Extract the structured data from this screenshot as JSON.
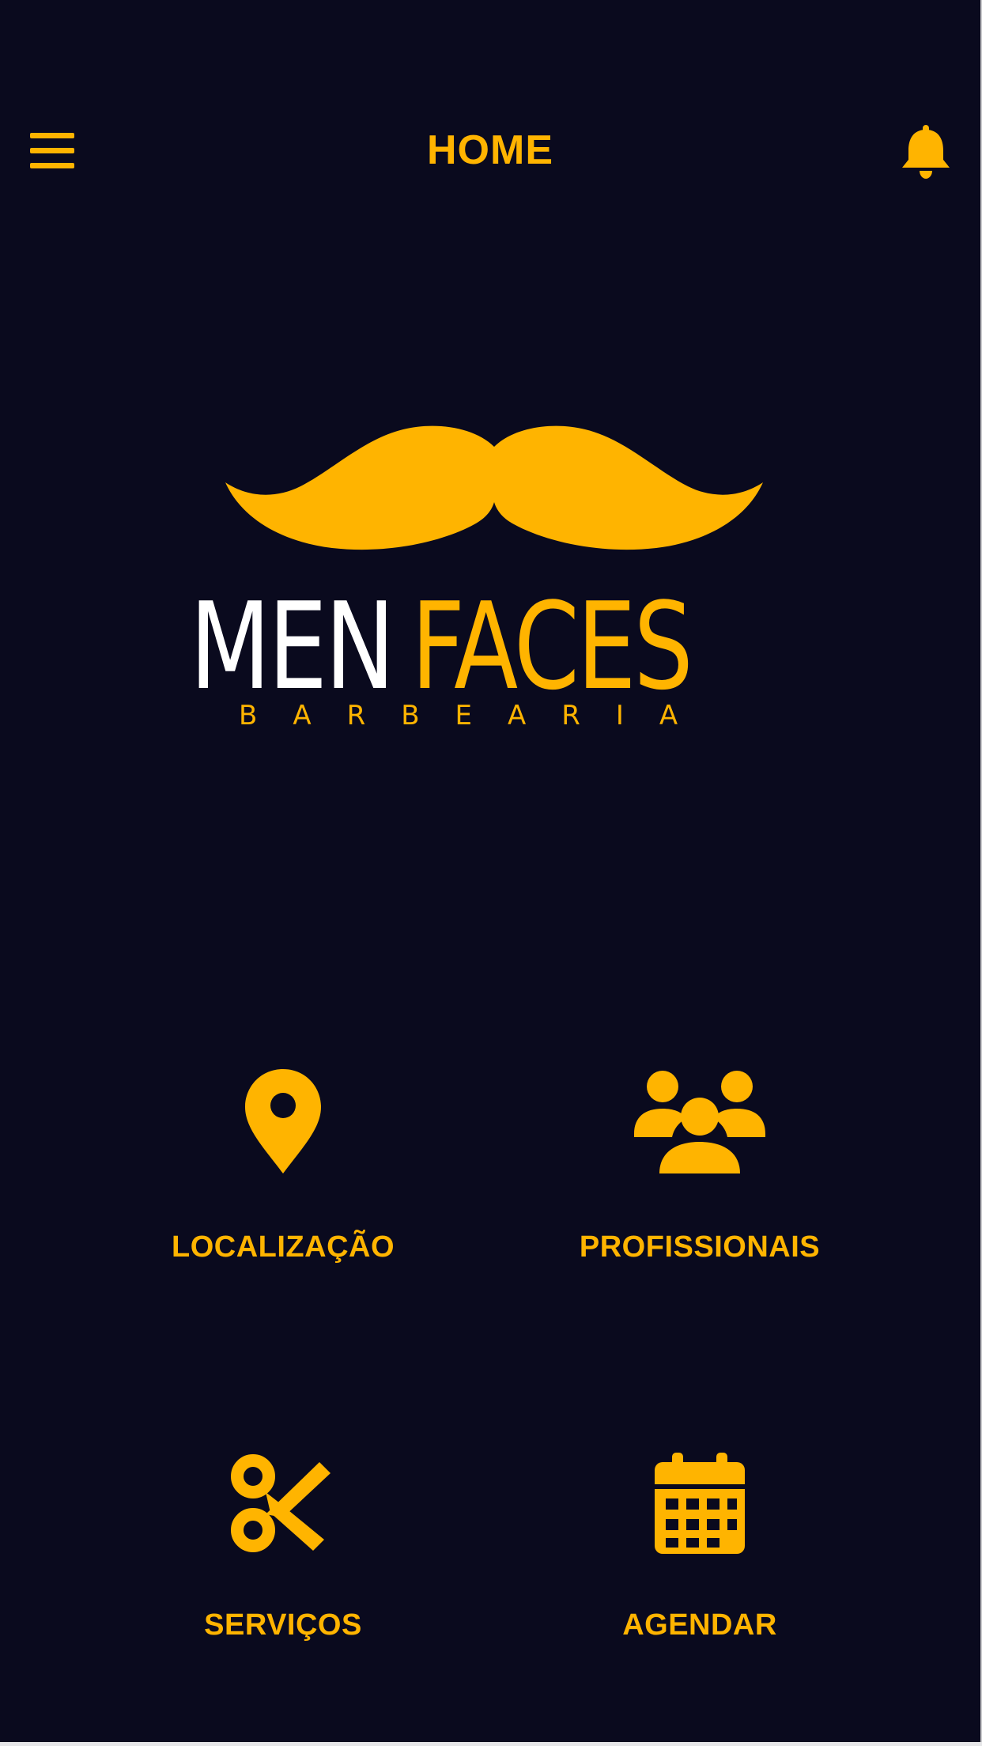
{
  "header": {
    "menu_icon": "hamburger-menu-icon",
    "title": "HOME",
    "notification_icon": "bell-icon"
  },
  "logo": {
    "word1": "MEN",
    "word2": "FACES",
    "subtitle": "BARBEARIA",
    "graphic": "mustache-logo"
  },
  "menu": {
    "items": [
      {
        "label": "LOCALIZAÇÃO",
        "icon": "map-pin-icon"
      },
      {
        "label": "PROFISSIONAIS",
        "icon": "users-group-icon"
      },
      {
        "label": "SERVIÇOS",
        "icon": "scissors-icon"
      },
      {
        "label": "AGENDAR",
        "icon": "calendar-icon"
      }
    ]
  },
  "colors": {
    "background": "#0a0a1e",
    "accent": "#ffb400",
    "logo_white": "#ffffff"
  }
}
